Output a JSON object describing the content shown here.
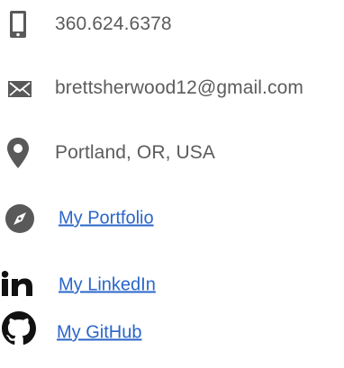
{
  "contact": {
    "phone": "360.624.6378",
    "email": "brettsherwood12@gmail.com",
    "location": "Portland, OR, USA"
  },
  "links": {
    "portfolio": "My Portfolio",
    "linkedin": "My LinkedIn",
    "github": "My GitHub"
  },
  "icons": {
    "phone": "mobile-phone-icon",
    "email": "envelope-icon",
    "location": "map-marker-icon",
    "portfolio": "compass-icon",
    "linkedin": "linkedin-icon",
    "github": "github-icon"
  },
  "colors": {
    "icon": "#595959",
    "text": "#5c5c5c",
    "link": "#2a66c9",
    "linkedin": "#111111",
    "github": "#111111"
  }
}
